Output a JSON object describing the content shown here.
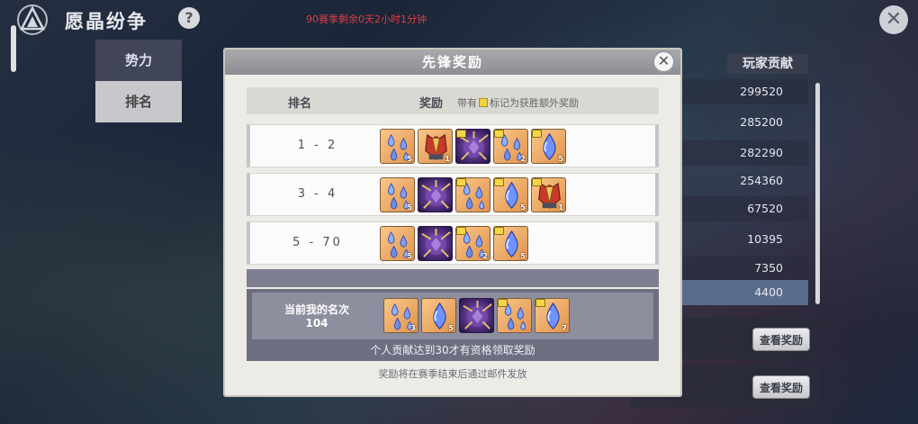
{
  "topbar": {
    "title": "愿晶纷争",
    "help": "?",
    "season_timer": "90赛季剩余0天2小时1分钟",
    "close": "✕"
  },
  "side_tabs": [
    {
      "label": "势力"
    },
    {
      "label": "排名"
    }
  ],
  "leaderboard": {
    "header": "玩家贡献",
    "values": [
      "299520",
      "285200",
      "282290",
      "254360",
      "67520",
      "10395",
      "7350",
      "4400"
    ]
  },
  "side_actions": {
    "view_reward_1": "查看奖励",
    "view_reward_2": "查看奖励"
  },
  "modal": {
    "title": "先锋奖励",
    "close": "✕",
    "header_rank": "排名",
    "header_reward": "奖励",
    "header_note_prefix": "带有",
    "header_note_suffix": "标记为获胜额外奖励",
    "rows": [
      {
        "rank": "1 - 2",
        "items": [
          {
            "kind": "drops",
            "bg": "orange",
            "count": "5",
            "crown": false
          },
          {
            "kind": "armor",
            "bg": "orange",
            "count": "1",
            "crown": false
          },
          {
            "kind": "crystal",
            "bg": "purple",
            "count": "",
            "crown": true
          },
          {
            "kind": "drops",
            "bg": "orange",
            "count": "2",
            "crown": true
          },
          {
            "kind": "drop",
            "bg": "orange",
            "count": "5",
            "crown": true
          }
        ]
      },
      {
        "rank": "3 - 4",
        "items": [
          {
            "kind": "drops",
            "bg": "orange",
            "count": "5",
            "crown": false
          },
          {
            "kind": "crystal",
            "bg": "purple",
            "count": "",
            "crown": false
          },
          {
            "kind": "drops",
            "bg": "orange",
            "count": "",
            "crown": true
          },
          {
            "kind": "drop",
            "bg": "orange",
            "count": "5",
            "crown": true
          },
          {
            "kind": "armor",
            "bg": "orange",
            "count": "1",
            "crown": true
          }
        ]
      },
      {
        "rank": "5 - 70",
        "items": [
          {
            "kind": "drops",
            "bg": "orange",
            "count": "5",
            "crown": false
          },
          {
            "kind": "crystal",
            "bg": "purple",
            "count": "",
            "crown": false
          },
          {
            "kind": "drops",
            "bg": "orange",
            "count": "2",
            "crown": true
          },
          {
            "kind": "drop",
            "bg": "orange",
            "count": "5",
            "crown": true
          }
        ]
      }
    ],
    "my_rank_label": "当前我的名次",
    "my_rank_value": "104",
    "my_items": [
      {
        "kind": "drops",
        "bg": "orange",
        "count": "3",
        "crown": false
      },
      {
        "kind": "drop",
        "bg": "orange",
        "count": "5",
        "crown": false
      },
      {
        "kind": "crystal",
        "bg": "purple",
        "count": "",
        "crown": false
      },
      {
        "kind": "drops",
        "bg": "orange",
        "count": "",
        "crown": true
      },
      {
        "kind": "drop",
        "bg": "orange",
        "count": "7",
        "crown": true
      }
    ],
    "requirement": "个人贡献达到30才有资格领取奖励",
    "footnote": "奖励将在赛季结束后通过邮件发放"
  }
}
